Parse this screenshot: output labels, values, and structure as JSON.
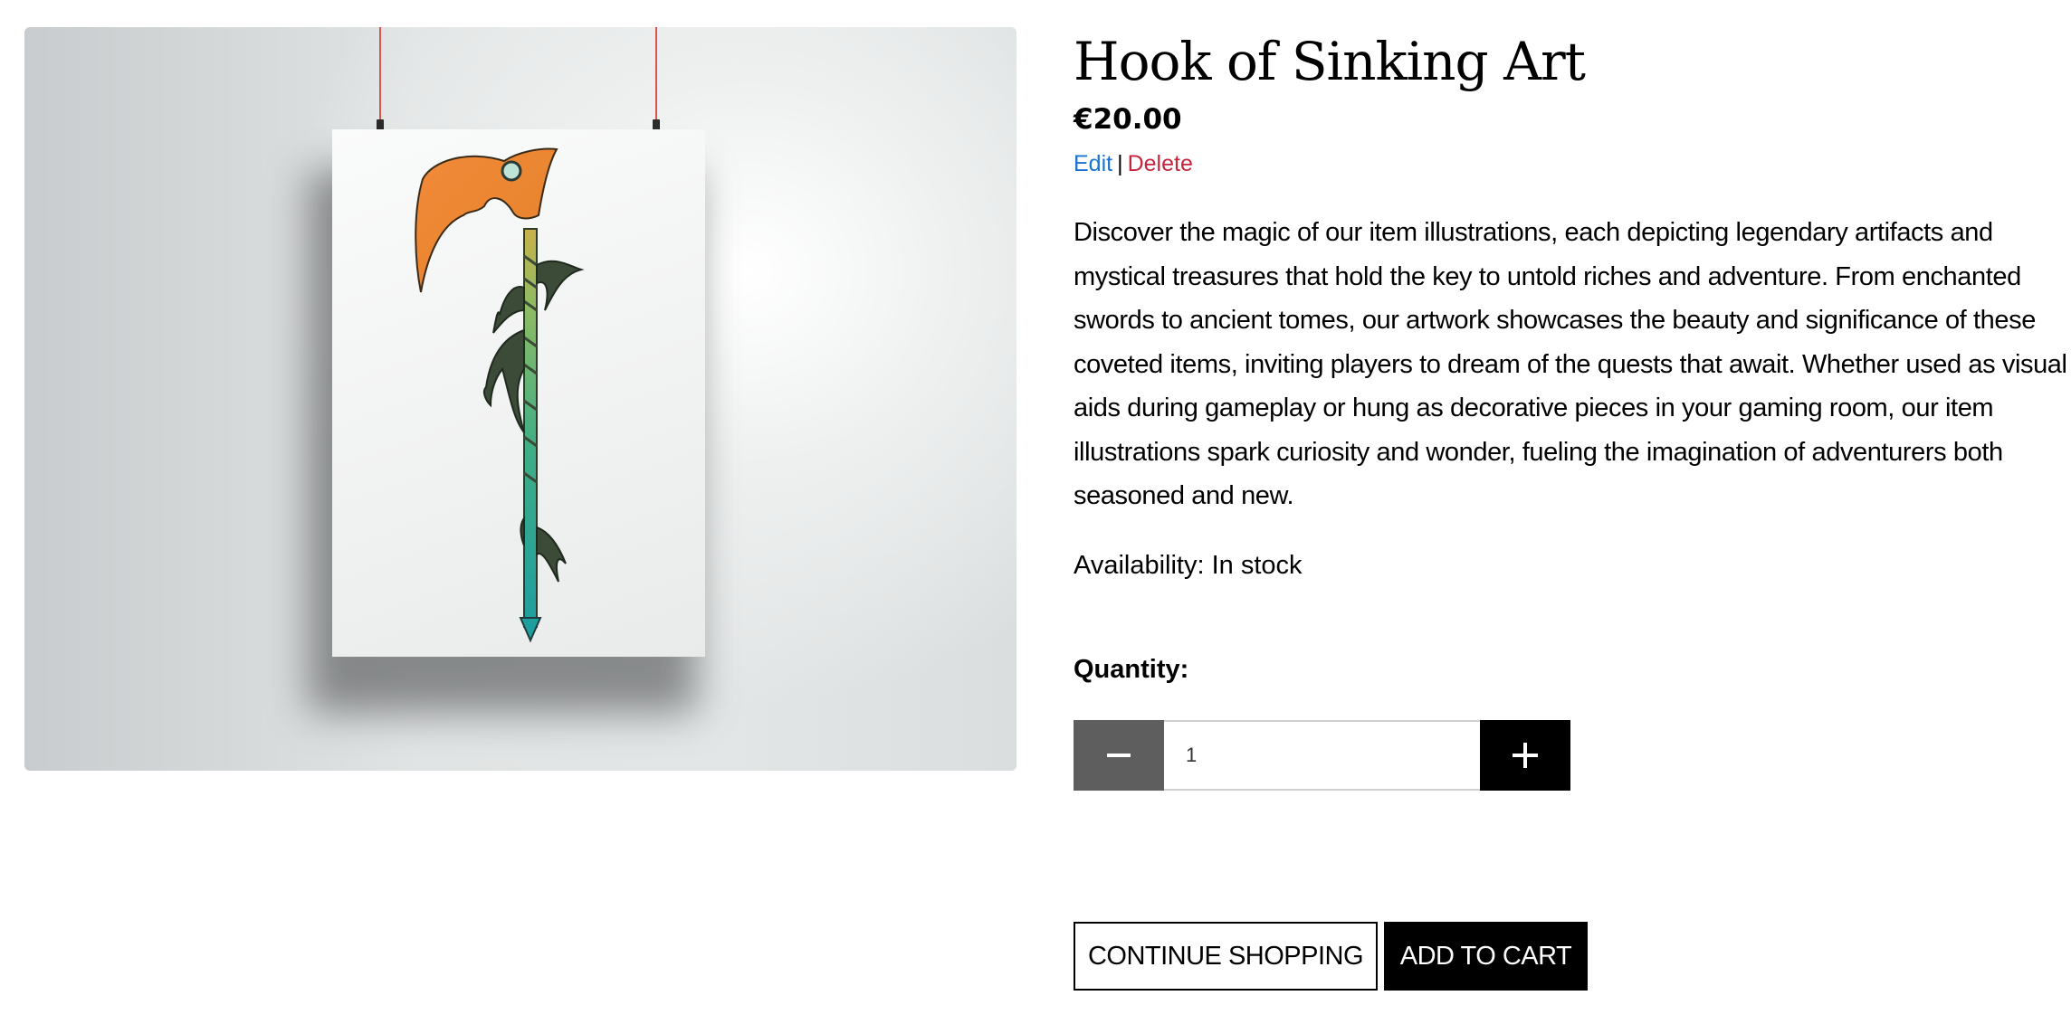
{
  "product": {
    "title": "Hook of Sinking Art",
    "price": "€20.00",
    "description": "Discover the magic of our item illustrations, each depicting legendary artifacts and mystical treasures that hold the key to untold riches and adventure. From enchanted swords to ancient tomes, our artwork showcases the beauty and significance of these coveted items, inviting players to dream of the quests that await. Whether used as visual aids during gameplay or hung as decorative pieces in your gaming room, our item illustrations spark curiosity and wonder, fueling the imagination of adventurers both seasoned and new.",
    "availability": "Availability: In stock"
  },
  "admin_actions": {
    "edit_label": "Edit",
    "separator": "|",
    "delete_label": "Delete"
  },
  "quantity": {
    "label": "Quantity:",
    "value": "1",
    "minus_icon": "minus-icon",
    "plus_icon": "plus-icon"
  },
  "buttons": {
    "continue_label": "CONTINUE SHOPPING",
    "add_label": "ADD TO CART"
  },
  "colors": {
    "edit_link": "#1a73d0",
    "delete_link": "#c8243b",
    "minus_button": "#5e5e5e",
    "plus_button": "#000000",
    "add_to_cart": "#000000"
  }
}
